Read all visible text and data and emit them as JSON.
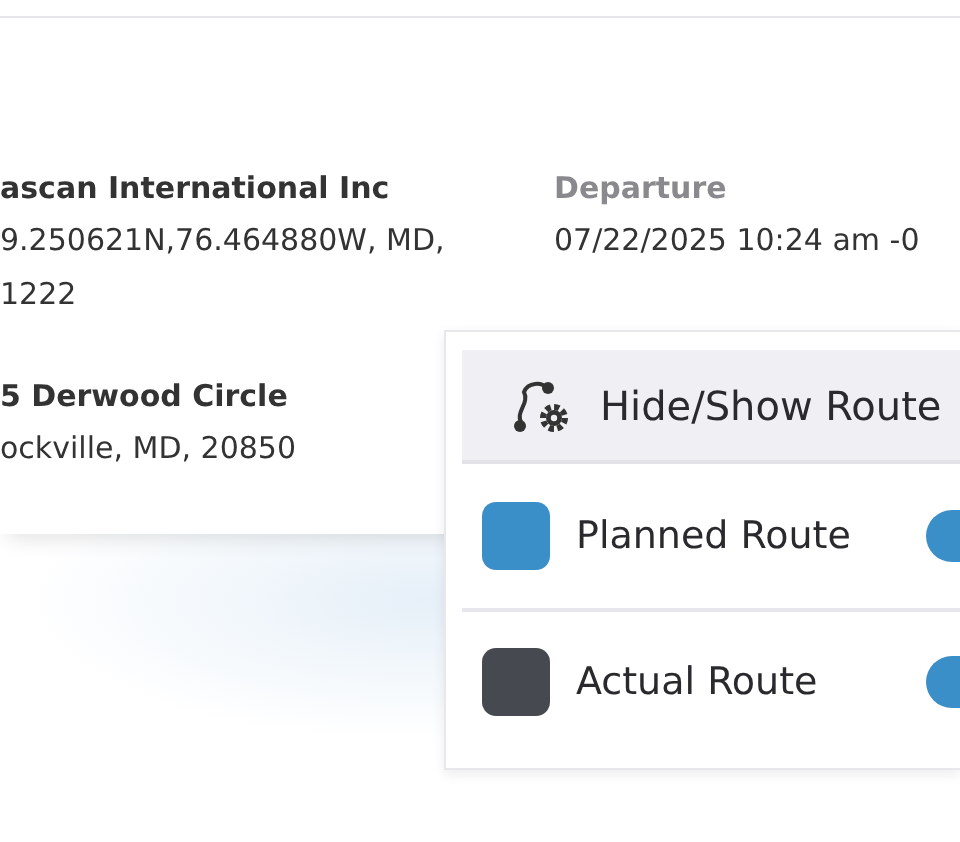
{
  "shipment": {
    "origin": {
      "name": "ascan International Inc",
      "address_lines": [
        "9.250621N,76.464880W, MD,",
        "1222"
      ]
    },
    "destination": {
      "name": "5 Derwood Circle",
      "address_lines": [
        "ockville, MD, 20850"
      ]
    },
    "departure": {
      "label": "Departure",
      "value": "07/22/2025 10:24 am -0"
    }
  },
  "routes_panel": {
    "title": "Hide/Show Route",
    "routes": [
      {
        "name": "Planned Route",
        "color": "#3a8fc8",
        "on": true
      },
      {
        "name": "Actual Route",
        "color": "#464a50",
        "on": true
      }
    ]
  }
}
